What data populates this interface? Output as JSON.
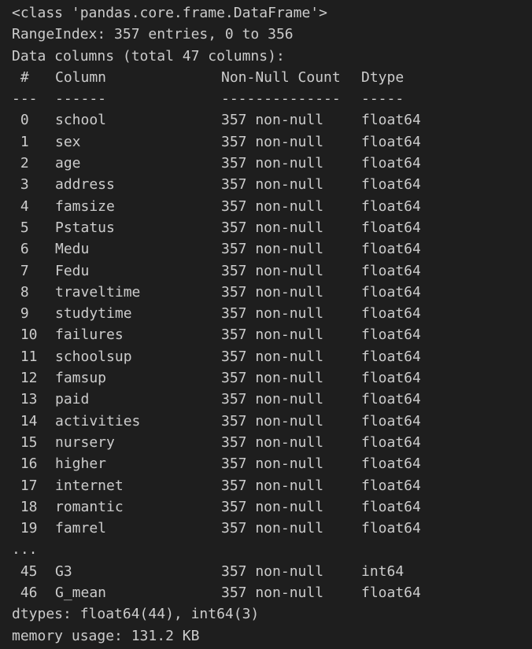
{
  "header": {
    "class_line": "<class 'pandas.core.frame.DataFrame'>",
    "range_index": "RangeIndex: 357 entries, 0 to 356",
    "data_columns": "Data columns (total 47 columns):"
  },
  "table": {
    "headers": {
      "num": " #",
      "column": "Column",
      "count": "Non-Null Count",
      "dtype": "Dtype"
    },
    "separators": {
      "num": "---",
      "column": "------",
      "count": "--------------",
      "dtype": "-----"
    },
    "rows": [
      {
        "num": " 0",
        "column": "school",
        "count": "357 non-null",
        "dtype": "float64"
      },
      {
        "num": " 1",
        "column": "sex",
        "count": "357 non-null",
        "dtype": "float64"
      },
      {
        "num": " 2",
        "column": "age",
        "count": "357 non-null",
        "dtype": "float64"
      },
      {
        "num": " 3",
        "column": "address",
        "count": "357 non-null",
        "dtype": "float64"
      },
      {
        "num": " 4",
        "column": "famsize",
        "count": "357 non-null",
        "dtype": "float64"
      },
      {
        "num": " 5",
        "column": "Pstatus",
        "count": "357 non-null",
        "dtype": "float64"
      },
      {
        "num": " 6",
        "column": "Medu",
        "count": "357 non-null",
        "dtype": "float64"
      },
      {
        "num": " 7",
        "column": "Fedu",
        "count": "357 non-null",
        "dtype": "float64"
      },
      {
        "num": " 8",
        "column": "traveltime",
        "count": "357 non-null",
        "dtype": "float64"
      },
      {
        "num": " 9",
        "column": "studytime",
        "count": "357 non-null",
        "dtype": "float64"
      },
      {
        "num": " 10",
        "column": "failures",
        "count": "357 non-null",
        "dtype": "float64"
      },
      {
        "num": " 11",
        "column": "schoolsup",
        "count": "357 non-null",
        "dtype": "float64"
      },
      {
        "num": " 12",
        "column": "famsup",
        "count": "357 non-null",
        "dtype": "float64"
      },
      {
        "num": " 13",
        "column": "paid",
        "count": "357 non-null",
        "dtype": "float64"
      },
      {
        "num": " 14",
        "column": "activities",
        "count": "357 non-null",
        "dtype": "float64"
      },
      {
        "num": " 15",
        "column": "nursery",
        "count": "357 non-null",
        "dtype": "float64"
      },
      {
        "num": " 16",
        "column": "higher",
        "count": "357 non-null",
        "dtype": "float64"
      },
      {
        "num": " 17",
        "column": "internet",
        "count": "357 non-null",
        "dtype": "float64"
      },
      {
        "num": " 18",
        "column": "romantic",
        "count": "357 non-null",
        "dtype": "float64"
      },
      {
        "num": " 19",
        "column": "famrel",
        "count": "357 non-null",
        "dtype": "float64"
      }
    ],
    "ellipsis": "...",
    "tail_rows": [
      {
        "num": " 45",
        "column": "G3",
        "count": "357 non-null",
        "dtype": "int64"
      },
      {
        "num": " 46",
        "column": "G_mean",
        "count": "357 non-null",
        "dtype": "float64"
      }
    ]
  },
  "footer": {
    "dtypes": "dtypes: float64(44), int64(3)",
    "memory": "memory usage: 131.2 KB"
  },
  "colors": {
    "background": "#1e1e1e",
    "text": "#cccccc"
  }
}
